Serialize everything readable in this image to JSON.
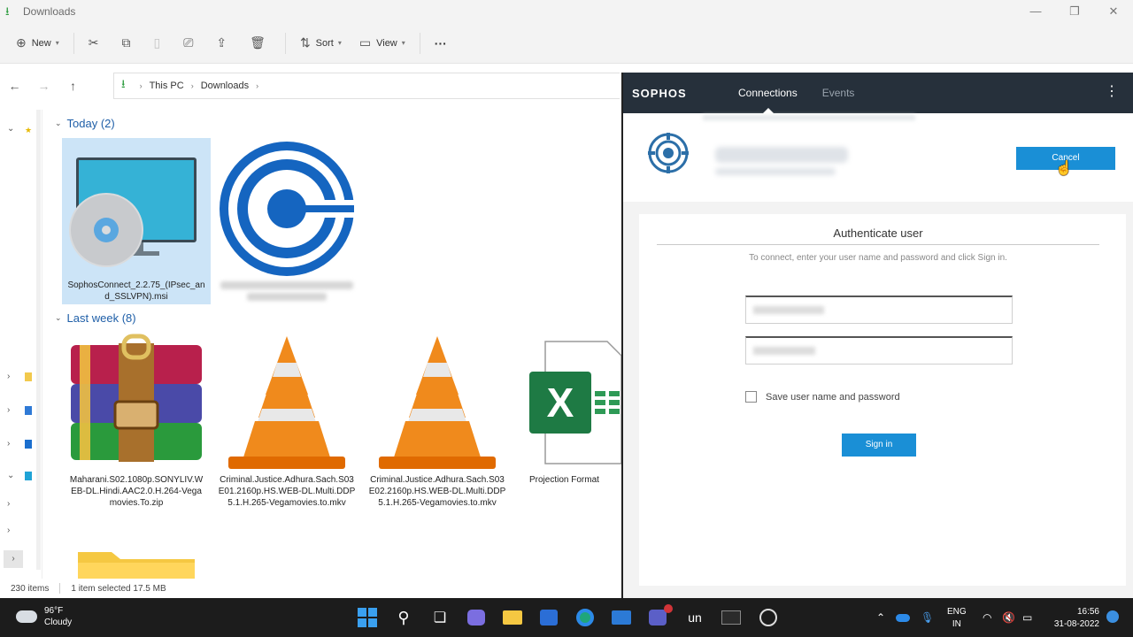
{
  "explorer": {
    "title": "Downloads",
    "toolbar": {
      "new_label": "New",
      "sort_label": "Sort",
      "view_label": "View",
      "more_label": "···"
    },
    "breadcrumb": [
      "This PC",
      "Downloads"
    ],
    "groups": [
      {
        "label": "Today (2)"
      },
      {
        "label": "Last week (8)"
      }
    ],
    "files_today": [
      {
        "name": "SophosConnect_2.2.75_(IPsec_and_SSLVPN).msi",
        "selected": true
      },
      {
        "name": "",
        "blurred": true
      }
    ],
    "files_last_week": [
      {
        "name": "Maharani.S02.1080p.SONYLIV.WEB-DL.Hindi.AAC2.0.H.264-Vegamovies.To.zip"
      },
      {
        "name": "Criminal.Justice.Adhura.Sach.S03E01.2160p.HS.WEB-DL.Multi.DDP5.1.H.265-Vegamovies.to.mkv"
      },
      {
        "name": "Criminal.Justice.Adhura.Sach.S03E02.2160p.HS.WEB-DL.Multi.DDP5.1.H.265-Vegamovies.to.mkv"
      },
      {
        "name": "Projection Format"
      }
    ],
    "status": {
      "items": "230 items",
      "selected": "1 item selected  17.5 MB"
    }
  },
  "sophos": {
    "logo": "SOPHOS",
    "tabs": [
      "Connections",
      "Events"
    ],
    "cancel_label": "Cancel",
    "auth": {
      "heading": "Authenticate user",
      "hint": "To connect, enter your user name and password and click Sign in.",
      "save_label": "Save user name and password",
      "signin_label": "Sign in"
    }
  },
  "taskbar": {
    "weather_temp": "96°F",
    "weather_desc": "Cloudy",
    "lang_top": "ENG",
    "lang_bottom": "IN",
    "time": "16:56",
    "date": "31-08-2022",
    "app_un_label": "un"
  },
  "colors": {
    "sophos_header": "#26303b",
    "accent_blue": "#1a8fd6",
    "folder_link": "#1f5fa8"
  }
}
